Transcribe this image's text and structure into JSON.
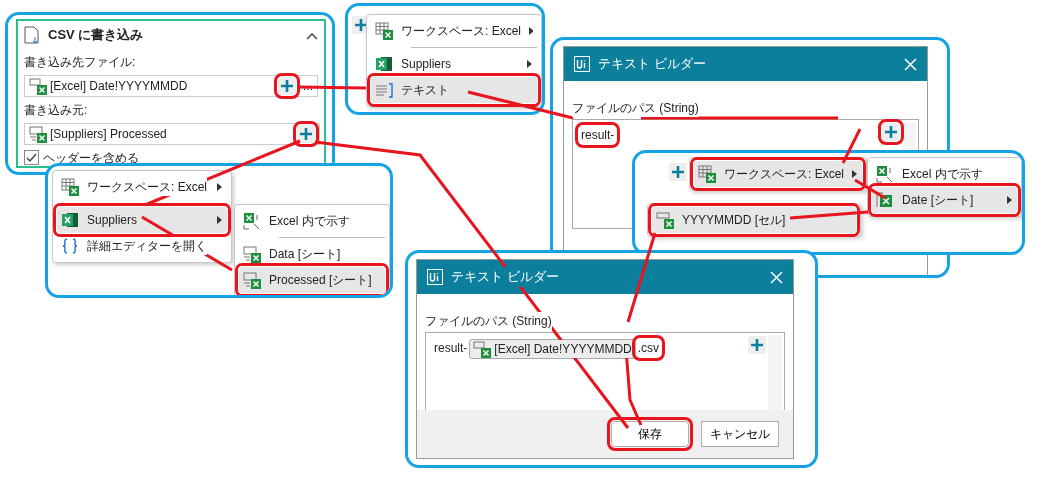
{
  "csv_panel": {
    "title": "CSV に書き込み",
    "expanded": true,
    "fields": [
      {
        "label": "書き込み先ファイル:",
        "kind": "file",
        "value": "[Excel] Date!YYYYMMDD",
        "plus_annotated": true,
        "browse": "..."
      },
      {
        "label": "書き込み元:",
        "kind": "sheet",
        "value": "[Suppliers] Processed",
        "plus_annotated": true
      }
    ],
    "checkbox": {
      "label": "ヘッダーを含める",
      "checked": true
    }
  },
  "menus": [
    {
      "items": [
        {
          "kind": "workspace",
          "label": "ワークスペース: Excel",
          "submenu": true,
          "selected": false,
          "annotated": false
        },
        {
          "kind": "separator"
        },
        {
          "kind": "excel",
          "label": "Suppliers",
          "submenu": true,
          "selected": false,
          "annotated": false
        },
        {
          "kind": "text",
          "label": "テキスト",
          "submenu": false,
          "selected": true,
          "annotated": true
        }
      ]
    },
    {
      "items": [
        {
          "kind": "workspace",
          "label": "ワークスペース: Excel",
          "submenu": true,
          "selected": false,
          "annotated": false
        },
        {
          "kind": "separator"
        },
        {
          "kind": "excel",
          "label": "Suppliers",
          "submenu": true,
          "selected": true,
          "annotated": true
        },
        {
          "kind": "editor",
          "label": "詳細エディターを開く",
          "submenu": false,
          "selected": false,
          "annotated": false
        }
      ]
    },
    {
      "items": [
        {
          "kind": "show",
          "label": "Excel 内で示す",
          "submenu": false,
          "selected": false,
          "annotated": false
        },
        {
          "kind": "separator"
        },
        {
          "kind": "sheet",
          "label": "Data [シート]",
          "submenu": false,
          "selected": false,
          "annotated": false
        },
        {
          "kind": "sheet",
          "label": "Processed [シート]",
          "submenu": false,
          "selected": true,
          "annotated": true
        }
      ]
    },
    {
      "items": [
        {
          "kind": "workspace",
          "label": "ワークスペース: Excel",
          "submenu": true,
          "selected": true,
          "annotated": true
        }
      ]
    },
    {
      "items": [
        {
          "kind": "cell",
          "label": "YYYYMMDD [セル]",
          "submenu": false,
          "selected": true,
          "annotated": true
        }
      ]
    },
    {
      "items": [
        {
          "kind": "show",
          "label": "Excel 内で示す",
          "submenu": false,
          "selected": false,
          "annotated": false
        },
        {
          "kind": "excel-sheet",
          "label": "Date [シート]",
          "submenu": true,
          "selected": true,
          "annotated": true
        }
      ]
    }
  ],
  "dialogs": [
    {
      "title": "テキスト ビルダー",
      "field_label": "ファイルのパス (String)",
      "plus_annotated": true,
      "content": [
        {
          "kind": "text",
          "text": "result-",
          "annotated": true
        }
      ]
    },
    {
      "title": "テキスト ビルダー",
      "field_label": "ファイルのパス (String)",
      "plus_annotated": false,
      "content": [
        {
          "kind": "text",
          "text": "result-",
          "annotated": false
        },
        {
          "kind": "chip",
          "text": "[Excel] Date!YYYYMMDD",
          "annotated": false
        },
        {
          "kind": "text",
          "text": ".csv",
          "annotated": true
        }
      ],
      "buttons": [
        {
          "label": "保存",
          "annotated": true
        },
        {
          "label": "キャンセル",
          "annotated": false
        }
      ]
    }
  ]
}
